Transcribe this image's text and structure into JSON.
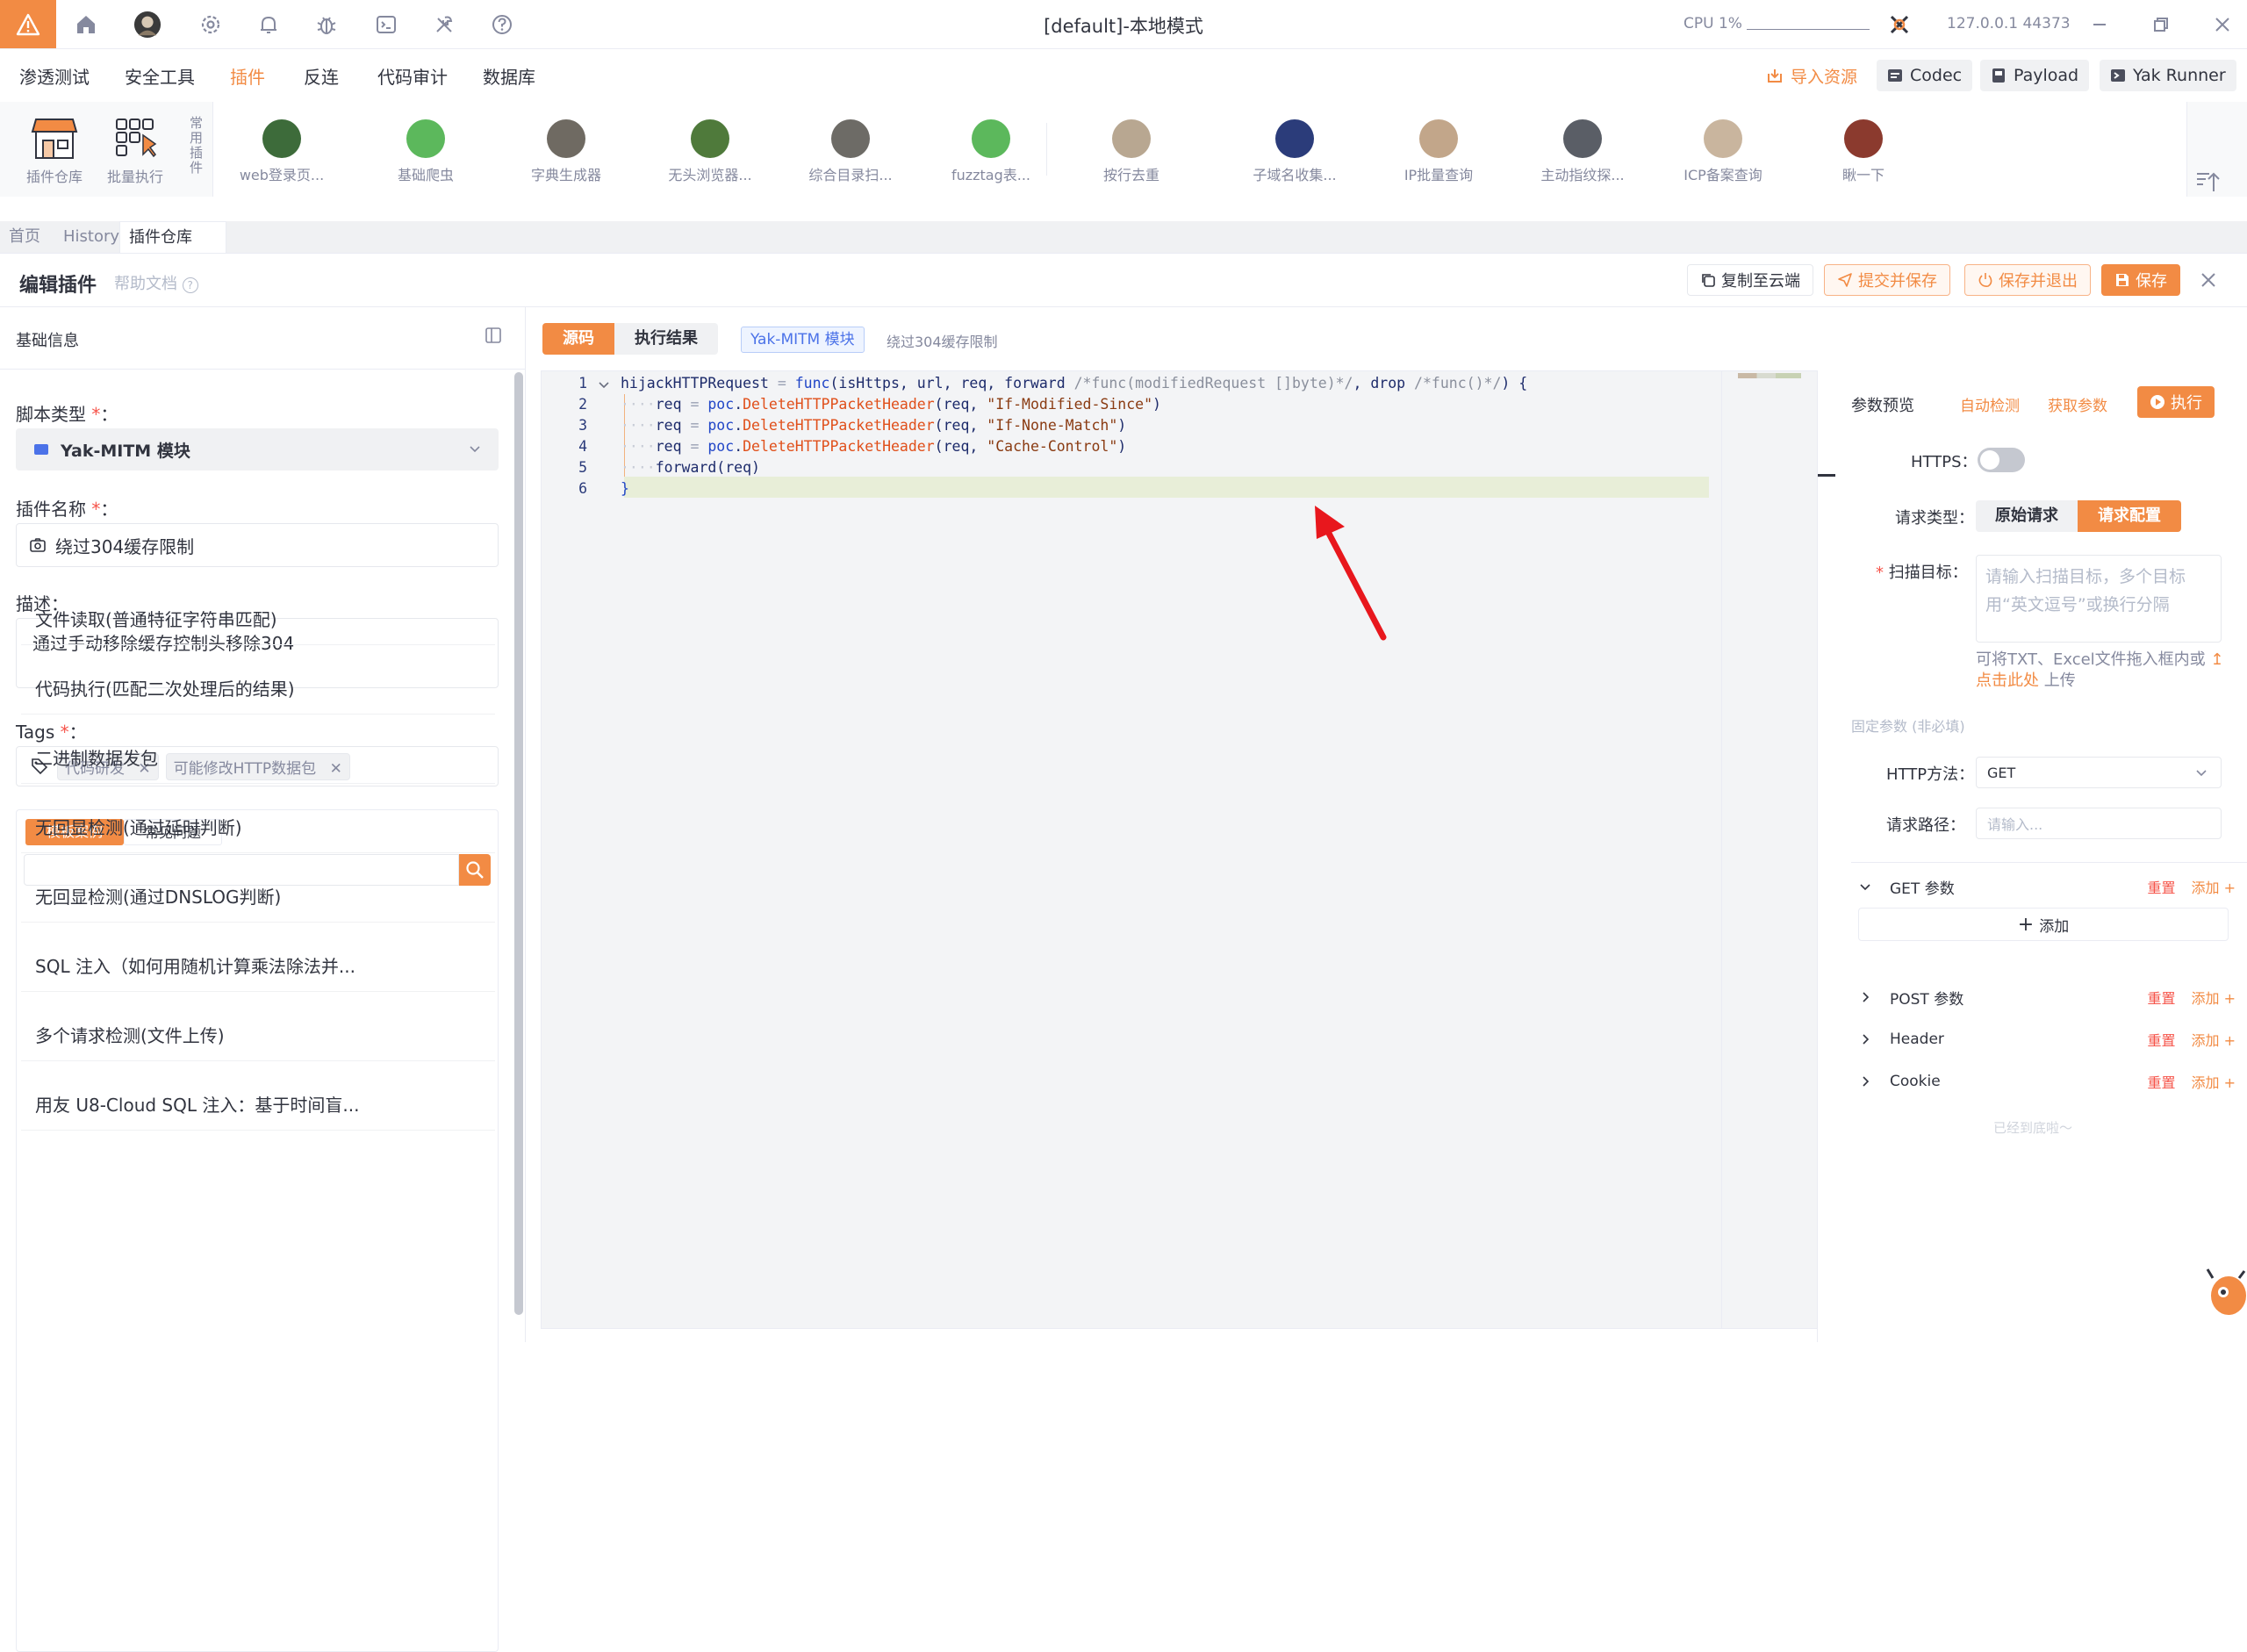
{
  "window": {
    "title": "[default]-本地模式",
    "cpu_label": "CPU 1%",
    "address": "127.0.0.1 44373"
  },
  "menu": {
    "items": [
      "渗透测试",
      "安全工具",
      "插件",
      "反连",
      "代码审计",
      "数据库"
    ],
    "active_index": 2,
    "import_label": "导入资源",
    "codec_label": "Codec",
    "payload_label": "Payload",
    "runner_label": "Yak Runner"
  },
  "plugin_bar": {
    "store_label": "插件仓库",
    "batch_label": "批量执行",
    "common_label": "常用插件",
    "plugins": [
      {
        "name": "web登录页...",
        "color": "#3d6b3a"
      },
      {
        "name": "基础爬虫",
        "color": "#5cb85c"
      },
      {
        "name": "字典生成器",
        "color": "#6f6a62"
      },
      {
        "name": "无头浏览器...",
        "color": "#4f7a3b"
      },
      {
        "name": "综合目录扫...",
        "color": "#6d6b66"
      },
      {
        "name": "fuzztag表...",
        "color": "#5cb85c"
      },
      {
        "name": "按行去重",
        "color": "#b8a791"
      },
      {
        "name": "子域名收集...",
        "color": "#2b3c7a"
      },
      {
        "name": "IP批量查询",
        "color": "#c2a68a"
      },
      {
        "name": "主动指纹探...",
        "color": "#5a5e66"
      },
      {
        "name": "ICP备案查询",
        "color": "#c9b59e"
      },
      {
        "name": "瞅一下",
        "color": "#8b3a2e"
      }
    ]
  },
  "tabs": {
    "items": [
      "首页",
      "History",
      "插件仓库"
    ],
    "active_index": 2
  },
  "editor": {
    "title": "编辑插件",
    "help_label": "帮助文档",
    "copy_cloud": "复制至云端",
    "submit_save": "提交并保存",
    "save_exit": "保存并退出",
    "save": "保存"
  },
  "left": {
    "section_title": "基础信息",
    "script_type_label": "脚本类型",
    "script_type_value": "Yak-MITM 模块",
    "plugin_name_label": "插件名称",
    "plugin_name_value": "绕过304缓存限制",
    "desc_label": "描述",
    "desc_value": "通过手动移除缓存控制头移除304",
    "tags_label": "Tags",
    "tags": [
      "代码研发",
      "可能修改HTTP数据包"
    ],
    "tmpl_tab_1": "模板案例",
    "tmpl_tab_2": "常见问题",
    "search_value": "",
    "templates": [
      "文件读取(普通特征字符串匹配)",
      "代码执行(匹配二次处理后的结果)",
      "二进制数据发包",
      "无回显检测(通过延时判断)",
      "无回显检测(通过DNSLOG判断)",
      "SQL 注入（如何用随机计算乘法除法并...",
      "多个请求检测(文件上传)",
      "用友 U8-Cloud SQL 注入：基于时间盲..."
    ]
  },
  "code": {
    "tab_source": "源码",
    "tab_result": "执行结果",
    "module_badge": "Yak-MITM 模块",
    "plugin_name": "绕过304缓存限制",
    "lines": [
      {
        "num": "1",
        "indent": "",
        "parts": [
          {
            "t": "hijackHTTPRequest",
            "c": "#1d2b6b"
          },
          {
            "t": " = ",
            "c": "#9aa0b4"
          },
          {
            "t": "func",
            "c": "#2146c7"
          },
          {
            "t": "(isHttps, url, req, forward ",
            "c": "#1d2b6b"
          },
          {
            "t": "/*func(modifiedRequest []byte)*/",
            "c": "#8a8f9c"
          },
          {
            "t": ", drop ",
            "c": "#1d2b6b"
          },
          {
            "t": "/*func()*/",
            "c": "#8a8f9c"
          },
          {
            "t": ") {",
            "c": "#1d2b6b"
          }
        ]
      },
      {
        "num": "2",
        "indent": "····",
        "parts": [
          {
            "t": "req",
            "c": "#1d2b6b"
          },
          {
            "t": " = ",
            "c": "#9aa0b4"
          },
          {
            "t": "poc",
            "c": "#2146c7"
          },
          {
            "t": ".",
            "c": "#1d2b6b"
          },
          {
            "t": "DeleteHTTPPacketHeader",
            "c": "#e04f1a"
          },
          {
            "t": "(req, ",
            "c": "#1d2b6b"
          },
          {
            "t": "\"If-Modified-Since\"",
            "c": "#8a3b12"
          },
          {
            "t": ")",
            "c": "#1d2b6b"
          }
        ]
      },
      {
        "num": "3",
        "indent": "····",
        "parts": [
          {
            "t": "req",
            "c": "#1d2b6b"
          },
          {
            "t": " = ",
            "c": "#9aa0b4"
          },
          {
            "t": "poc",
            "c": "#2146c7"
          },
          {
            "t": ".",
            "c": "#1d2b6b"
          },
          {
            "t": "DeleteHTTPPacketHeader",
            "c": "#e04f1a"
          },
          {
            "t": "(req, ",
            "c": "#1d2b6b"
          },
          {
            "t": "\"If-None-Match\"",
            "c": "#8a3b12"
          },
          {
            "t": ")",
            "c": "#1d2b6b"
          }
        ]
      },
      {
        "num": "4",
        "indent": "····",
        "parts": [
          {
            "t": "req",
            "c": "#1d2b6b"
          },
          {
            "t": " = ",
            "c": "#9aa0b4"
          },
          {
            "t": "poc",
            "c": "#2146c7"
          },
          {
            "t": ".",
            "c": "#1d2b6b"
          },
          {
            "t": "DeleteHTTPPacketHeader",
            "c": "#e04f1a"
          },
          {
            "t": "(req, ",
            "c": "#1d2b6b"
          },
          {
            "t": "\"Cache-Control\"",
            "c": "#8a3b12"
          },
          {
            "t": ")",
            "c": "#1d2b6b"
          }
        ]
      },
      {
        "num": "5",
        "indent": "····",
        "parts": [
          {
            "t": "forward(req)",
            "c": "#1d2b6b"
          }
        ]
      },
      {
        "num": "6",
        "indent": "",
        "parts": [
          {
            "t": "}",
            "c": "#2146c7"
          }
        ]
      }
    ]
  },
  "right": {
    "param_preview": "参数预览",
    "auto_detect": "自动检测",
    "get_params": "获取参数",
    "run": "执行",
    "https_label": "HTTPS",
    "req_type_label": "请求类型",
    "req_raw": "原始请求",
    "req_config": "请求配置",
    "target_label": "扫描目标",
    "target_placeholder": "请输入扫描目标，多个目标用“英文逗号”或换行分隔",
    "upload_hint_pre": "可将TXT、Excel文件拖入框内或",
    "upload_link": "点击此处",
    "upload_hint_post": "上传",
    "fixed_params": "固定参数 (非必填)",
    "method_label": "HTTP方法",
    "method_value": "GET",
    "path_label": "请求路径",
    "path_placeholder": "请输入...",
    "sections": [
      "GET 参数",
      "POST 参数",
      "Header",
      "Cookie"
    ],
    "reset": "重置",
    "add": "添加",
    "add_row": "添加",
    "bottom_hint": "已经到底啦～"
  },
  "colors": {
    "accent": "#f28b44",
    "required": "#f6544a",
    "arrow": "#e8171d"
  }
}
